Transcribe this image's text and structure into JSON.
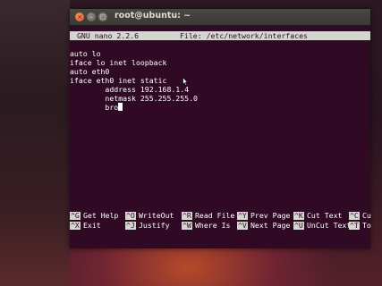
{
  "window": {
    "title": "root@ubuntu: ~",
    "buttons": {
      "close": "×",
      "minimize": "–",
      "maximize": "□"
    }
  },
  "nano": {
    "version": "GNU nano 2.2.6",
    "file": "File: /etc/network/interfaces"
  },
  "file_lines": [
    "auto lo",
    "iface lo inet loopback",
    "auto eth0",
    "iface eth0 inet static",
    "        address 192.168.1.4",
    "        netmask 255.255.255.0",
    "        bro"
  ],
  "shortcuts_row1": [
    {
      "key": "^G",
      "label": "Get Help"
    },
    {
      "key": "^O",
      "label": "WriteOut"
    },
    {
      "key": "^R",
      "label": "Read File"
    },
    {
      "key": "^Y",
      "label": "Prev Page"
    },
    {
      "key": "^K",
      "label": "Cut Text"
    },
    {
      "key": "^C",
      "label": "Cu"
    }
  ],
  "shortcuts_row2": [
    {
      "key": "^X",
      "label": "Exit"
    },
    {
      "key": "^J",
      "label": "Justify"
    },
    {
      "key": "^W",
      "label": "Where Is"
    },
    {
      "key": "^V",
      "label": "Next Page"
    },
    {
      "key": "^U",
      "label": "UnCut Text"
    },
    {
      "key": "^T",
      "label": "To"
    }
  ],
  "colors": {
    "terminal_bg": "#300a24",
    "terminal_fg": "#ffffff",
    "highlight_bg": "#d3d7cf",
    "close_button": "#df4a16"
  }
}
